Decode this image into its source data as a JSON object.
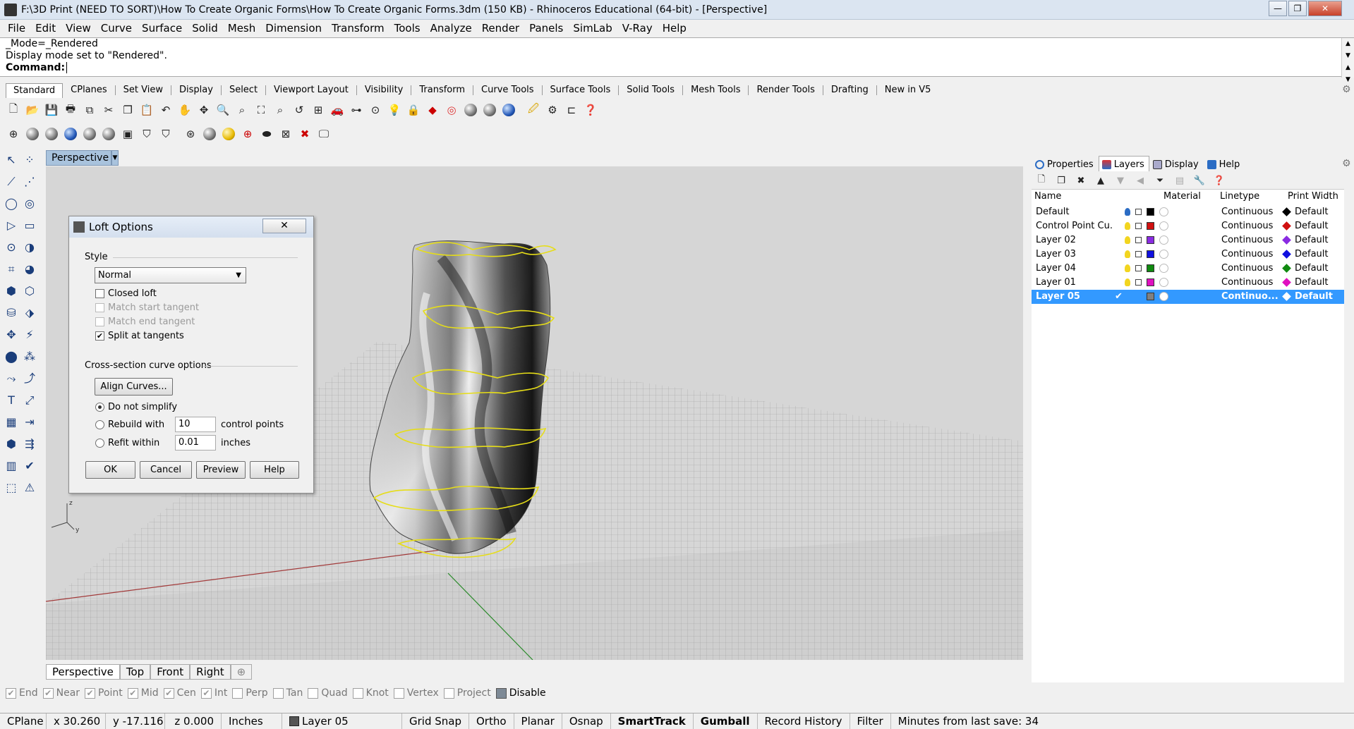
{
  "window": {
    "title": "F:\\3D Print (NEED TO SORT)\\How To Create Organic Forms\\How To Create Organic Forms.3dm (150 KB) - Rhinoceros Educational (64-bit) - [Perspective]",
    "minimize": "—",
    "restore": "❐",
    "close": "✕"
  },
  "menu": [
    "File",
    "Edit",
    "View",
    "Curve",
    "Surface",
    "Solid",
    "Mesh",
    "Dimension",
    "Transform",
    "Tools",
    "Analyze",
    "Render",
    "Panels",
    "SimLab",
    "V-Ray",
    "Help"
  ],
  "command": {
    "history": [
      "_Mode=_Rendered",
      "Display mode set to \"Rendered\"."
    ],
    "prompt": "Command:",
    "input": ""
  },
  "toolbar_tabs": [
    "Standard",
    "CPlanes",
    "Set View",
    "Display",
    "Select",
    "Viewport Layout",
    "Visibility",
    "Transform",
    "Curve Tools",
    "Surface Tools",
    "Solid Tools",
    "Mesh Tools",
    "Render Tools",
    "Drafting",
    "New in V5"
  ],
  "toolbar1_icons": [
    "new-file-icon",
    "open-file-icon",
    "save-icon",
    "print-icon",
    "import-icon",
    "cut-icon",
    "copy-icon",
    "paste-icon",
    "undo-icon",
    "pan-icon",
    "rotate-view-icon",
    "zoom-dynamic-icon",
    "zoom-window-icon",
    "zoom-extents-icon",
    "zoom-selected-icon",
    "undo-view-icon",
    "four-viewports-icon",
    "car-icon",
    "toggle-visibility-icon",
    "camera-icon",
    "light-icon",
    "lock-icon",
    "layer-icon",
    "color-wheel-icon",
    "rendered-sphere-icon",
    "render-icon",
    "material-sphere-icon",
    "cursor-toggle-icon",
    "options-icon",
    "analysis-icon",
    "help-icon"
  ],
  "viewport": {
    "name": "Perspective",
    "axis_labels": {
      "z": "z",
      "y": "y"
    }
  },
  "loft_dialog": {
    "title": "Loft Options",
    "close": "✕",
    "style_label": "Style",
    "style_value": "Normal",
    "checks": [
      {
        "label": "Closed loft",
        "checked": false,
        "enabled": true
      },
      {
        "label": "Match start tangent",
        "checked": false,
        "enabled": false
      },
      {
        "label": "Match end tangent",
        "checked": false,
        "enabled": false
      },
      {
        "label": "Split at tangents",
        "checked": true,
        "enabled": true
      }
    ],
    "cross_section_label": "Cross-section curve options",
    "align_button": "Align Curves...",
    "radios": [
      {
        "label": "Do not simplify",
        "selected": true
      },
      {
        "label": "Rebuild with",
        "selected": false,
        "value": "10",
        "unit": "control points"
      },
      {
        "label": "Refit within",
        "selected": false,
        "value": "0.01",
        "unit": "inches"
      }
    ],
    "buttons": [
      "OK",
      "Cancel",
      "Preview",
      "Help"
    ]
  },
  "panel": {
    "tabs": [
      "Properties",
      "Layers",
      "Display",
      "Help"
    ],
    "active_tab": "Layers",
    "columns": [
      "Name",
      "Material",
      "Linetype",
      "Print Width"
    ],
    "layers": [
      {
        "name": "Default",
        "color": "#000000",
        "linetype": "Continuous",
        "print_width": "Default",
        "selected": false
      },
      {
        "name": "Control Point Cu...",
        "color": "#d01010",
        "linetype": "Continuous",
        "print_width": "Default",
        "selected": false
      },
      {
        "name": "Layer 02",
        "color": "#8a2be2",
        "linetype": "Continuous",
        "print_width": "Default",
        "selected": false
      },
      {
        "name": "Layer 03",
        "color": "#1010e0",
        "linetype": "Continuous",
        "print_width": "Default",
        "selected": false
      },
      {
        "name": "Layer 04",
        "color": "#108a10",
        "linetype": "Continuous",
        "print_width": "Default",
        "selected": false
      },
      {
        "name": "Layer 01",
        "color": "#e010c0",
        "linetype": "Continuous",
        "print_width": "Default",
        "selected": false
      },
      {
        "name": "Layer 05",
        "color": "#808080",
        "linetype": "Continuo...",
        "print_width": "Default",
        "selected": true,
        "current_mark": "✔"
      }
    ]
  },
  "viewport_tabs": [
    "Perspective",
    "Top",
    "Front",
    "Right",
    "⊕"
  ],
  "osnaps": [
    {
      "label": "End",
      "checked": true
    },
    {
      "label": "Near",
      "checked": true
    },
    {
      "label": "Point",
      "checked": true
    },
    {
      "label": "Mid",
      "checked": true
    },
    {
      "label": "Cen",
      "checked": true
    },
    {
      "label": "Int",
      "checked": true
    },
    {
      "label": "Perp",
      "checked": false
    },
    {
      "label": "Tan",
      "checked": false
    },
    {
      "label": "Quad",
      "checked": false
    },
    {
      "label": "Knot",
      "checked": false
    },
    {
      "label": "Vertex",
      "checked": false
    },
    {
      "label": "Project",
      "checked": false
    },
    {
      "label": "Disable",
      "checked": false,
      "disable": true
    }
  ],
  "status": {
    "cplane": "CPlane",
    "x": "x 30.260",
    "y": "y -17.116",
    "z": "z 0.000",
    "units": "Inches",
    "layer": "Layer 05",
    "grid_snap": "Grid Snap",
    "ortho": "Ortho",
    "planar": "Planar",
    "osnap": "Osnap",
    "smarttrack": "SmartTrack",
    "gumball": "Gumball",
    "record_history": "Record History",
    "filter": "Filter",
    "minutes": "Minutes from last save: 34"
  }
}
